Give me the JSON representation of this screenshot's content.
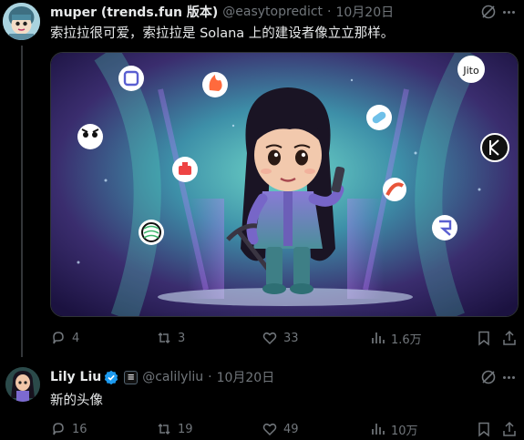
{
  "tweet1": {
    "display_name": "muper (trends.fun 版本)",
    "handle": "@easytopredict",
    "separator": "·",
    "date": "10月20日",
    "text": "索拉拉很可爱，索拉拉是 Solana 上的建设者像立立那样。",
    "media": {
      "logos": [
        "Jito"
      ]
    },
    "stats": {
      "replies": "4",
      "reposts": "3",
      "likes": "33",
      "views": "1.6万"
    }
  },
  "tweet2": {
    "display_name": "Lily Liu",
    "affiliate_glyph": "≡",
    "handle": "@calilyliu",
    "separator": "·",
    "date": "10月20日",
    "text": "新的头像",
    "stats": {
      "replies": "16",
      "reposts": "19",
      "likes": "49",
      "views": "10万"
    }
  },
  "colors": {
    "background": "#000000",
    "text": "#e7e9ea",
    "muted": "#71767b",
    "verified": "#1d9bf0"
  },
  "icons": [
    "grok-icon",
    "more-icon",
    "reply-icon",
    "repost-icon",
    "like-icon",
    "views-icon",
    "bookmark-icon",
    "share-icon",
    "verified-icon"
  ]
}
